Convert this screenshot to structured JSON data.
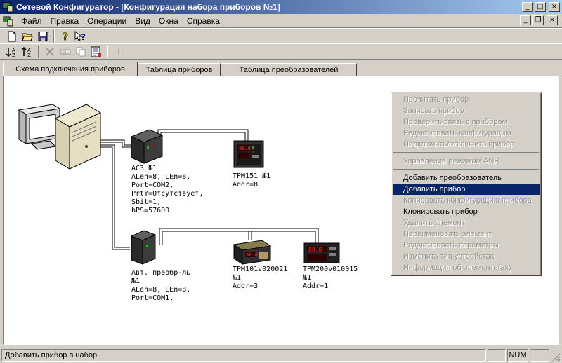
{
  "window": {
    "title": "Сетевой Конфигуратор - [Конфигурация набора приборов №1]",
    "minimize": "_",
    "maximize": "□",
    "close": "×",
    "restore": "❐"
  },
  "menu": {
    "items": [
      "Файл",
      "Правка",
      "Операции",
      "Вид",
      "Окна",
      "Справка"
    ]
  },
  "toolbar1": {
    "new_icon": "new-document-icon",
    "open_icon": "open-folder-icon",
    "save_icon": "save-disk-icon",
    "help_icon": "help-icon",
    "context_help_icon": "context-help-icon"
  },
  "toolbar2": {
    "sort_asc_icon": "sort-ascending-icon",
    "sort_desc_icon": "sort-descending-icon",
    "info_label": "i"
  },
  "tabs": [
    {
      "label": "Схема подключения приборов",
      "active": true
    },
    {
      "label": "Таблица приборов",
      "active": false
    },
    {
      "label": "Таблица преобразователей",
      "active": false
    }
  ],
  "devices": {
    "ac3_label": "АС3 №1\nALen=8, LEn=8,\nPort=COM2,\nPrtY=Отсутствует,\nSbit=1,\nbPS=57600",
    "trm151_label": "ТРМ151 №1\nAddr=8",
    "auto_conv_label": "Авт. преобр-ль\n№1\nALen=8, LEn=8,\nPort=COM1,",
    "trm101_label": "ТРМ101v020021\n№1\nAddr=3",
    "trm200_label": "ТРМ200v010015\n№1\nAddr=1",
    "trm151_display": "88.8",
    "trm101_display": "88.8",
    "trm200_display": "88.8"
  },
  "context_menu": {
    "items": [
      {
        "label": "Прочитать прибор",
        "enabled": false
      },
      {
        "label": "Записать прибор",
        "enabled": false
      },
      {
        "label": "Проверить связь с прибором",
        "enabled": false
      },
      {
        "label": "Редактировать конфигурацию",
        "enabled": false
      },
      {
        "label": "Подключить/отключить прибор",
        "enabled": false
      },
      {
        "sep": true
      },
      {
        "label": "Управление режимом ANR",
        "enabled": false
      },
      {
        "sep": true
      },
      {
        "label": "Добавить преобразователь",
        "enabled": true
      },
      {
        "label": "Добавить прибор",
        "enabled": true,
        "selected": true
      },
      {
        "label": "Копировать конфигурацию прибора",
        "enabled": false
      },
      {
        "label": "Клонировать прибор",
        "enabled": true
      },
      {
        "label": "Удалить элемент",
        "enabled": false
      },
      {
        "label": "Переименовать элемент",
        "enabled": false
      },
      {
        "label": "Редактировать параметры",
        "enabled": false
      },
      {
        "label": "Изменить тип устройства",
        "enabled": false
      },
      {
        "label": "Информация об элементе(ах)",
        "enabled": false
      }
    ]
  },
  "status": {
    "text": "Добавить прибор в набор",
    "panel1": "",
    "num": "NUM",
    "panel3": ""
  },
  "colors": {
    "title_start": "#0a246a",
    "title_end": "#a6caf0",
    "selection": "#0a246a",
    "display_red": "#ff2a1a"
  }
}
